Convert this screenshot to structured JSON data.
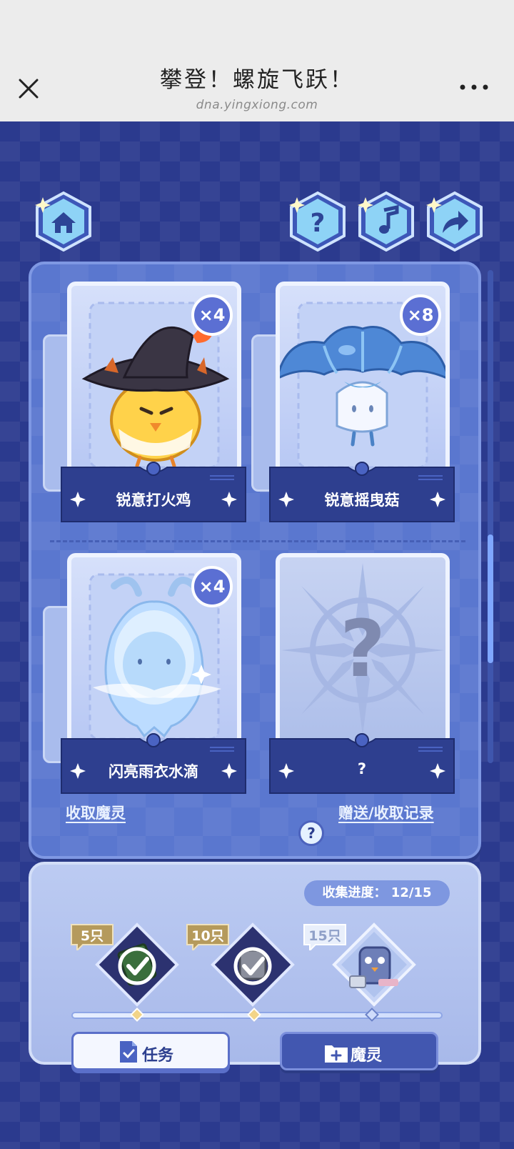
{
  "browser": {
    "title": "攀登！螺旋飞跃！",
    "url": "dna.yingxiong.com",
    "close_icon": "close-icon",
    "more_icon": "more-horizontal-icon"
  },
  "nav": {
    "home_icon": "home-icon",
    "help_icon": "question-icon",
    "music_icon": "music-note-icon",
    "share_icon": "share-arrow-icon"
  },
  "cards": [
    {
      "name": "锐意打火鸡",
      "count": "×4",
      "art": "fire-chick-witch-hat"
    },
    {
      "name": "锐意摇曳菇",
      "count": "×8",
      "art": "blue-jellyfish-mushroom"
    },
    {
      "name": "闪亮雨衣水滴",
      "count": "×4",
      "art": "water-drop-raincoat"
    },
    {
      "name": "?",
      "count": "",
      "art": "locked-question"
    }
  ],
  "links": {
    "receive": "收取魔灵",
    "history": "赠送/收取记录"
  },
  "progress": {
    "label": "收集进度：",
    "value": "12/15",
    "current": 12,
    "total": 15
  },
  "rewards": [
    {
      "tag": "5只",
      "claimed": true
    },
    {
      "tag": "10只",
      "claimed": true
    },
    {
      "tag": "15只",
      "claimed": false
    }
  ],
  "buttons": {
    "task": "任务",
    "spirit": "魔灵"
  },
  "colors": {
    "background": "#2b3a8e",
    "panel": "#5a77cf",
    "accent": "#7fa7ff",
    "badge": "#5b6fd3",
    "tag_gold": "#b59a5c"
  }
}
